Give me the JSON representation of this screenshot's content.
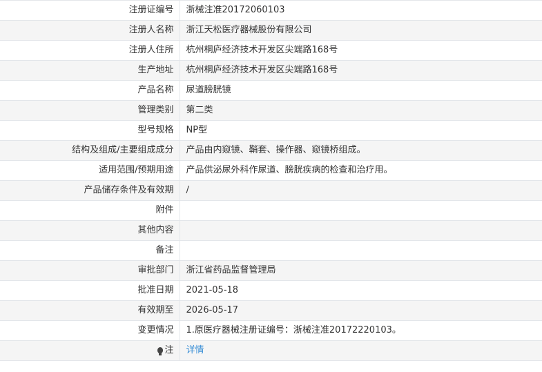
{
  "rows": [
    {
      "label": "注册证编号",
      "value": "浙械注准20172060103"
    },
    {
      "label": "注册人名称",
      "value": "浙江天松医疗器械股份有限公司"
    },
    {
      "label": "注册人住所",
      "value": "杭州桐庐经济技术开发区尖端路168号"
    },
    {
      "label": "生产地址",
      "value": "杭州桐庐经济技术开发区尖端路168号"
    },
    {
      "label": "产品名称",
      "value": "尿道膀胱镜"
    },
    {
      "label": "管理类别",
      "value": "第二类"
    },
    {
      "label": "型号规格",
      "value": "NP型"
    },
    {
      "label": "结构及组成/主要组成成分",
      "value": "产品由内窥镜、鞘套、操作器、窥镜桥组成。"
    },
    {
      "label": "适用范围/预期用途",
      "value": "产品供泌尿外科作尿道、膀胱疾病的检查和治疗用。"
    },
    {
      "label": "产品储存条件及有效期",
      "value": "/"
    },
    {
      "label": "附件",
      "value": ""
    },
    {
      "label": "其他内容",
      "value": ""
    },
    {
      "label": "备注",
      "value": ""
    },
    {
      "label": "审批部门",
      "value": "浙江省药品监督管理局"
    },
    {
      "label": "批准日期",
      "value": "2021-05-18"
    },
    {
      "label": "有效期至",
      "value": "2026-05-17"
    },
    {
      "label": "变更情况",
      "value": "1.原医疗器械注册证编号：浙械注准20172220103。"
    }
  ],
  "note": {
    "label": "注",
    "icon": "lightbulb-icon",
    "link_text": "详情",
    "link_color": "#3a8fd6"
  }
}
